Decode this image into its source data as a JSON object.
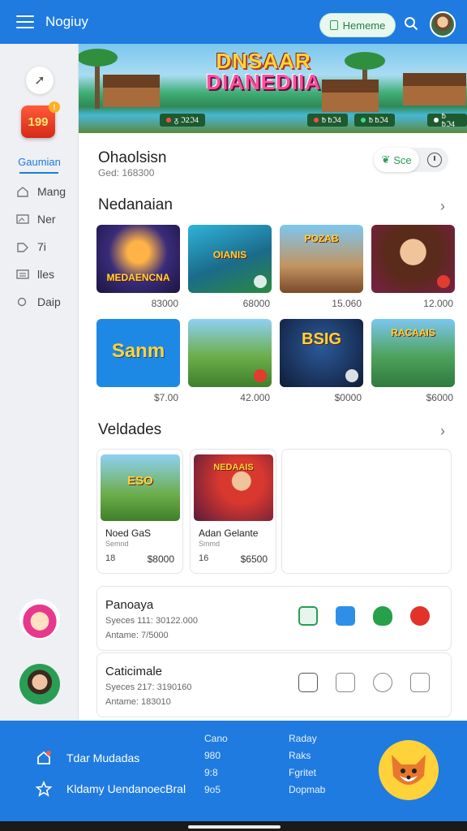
{
  "header": {
    "title": "Nogiuy",
    "home_label": "Hememe"
  },
  "banner": {
    "title_line1": "DNSAAR",
    "title_line2": "DIANEDIIA",
    "chips": [
      "ᵹ ℑ2ℑ4",
      "ƀ ƀℑ4",
      "ƀ ƀℑ4"
    ]
  },
  "sidebar": {
    "badge": "199",
    "badge_count": "!",
    "heading": "Gaumian",
    "items": [
      {
        "label": "Mang",
        "icon": "home-icon"
      },
      {
        "label": "Ner",
        "icon": "image-icon"
      },
      {
        "label": "7i",
        "icon": "tag-icon"
      },
      {
        "label": "lles",
        "icon": "list-icon"
      },
      {
        "label": "Dаip",
        "icon": "search-icon"
      }
    ]
  },
  "profile": {
    "name": "Ohaolsisn",
    "sub": "Ged: 168300",
    "see_label": "Sce"
  },
  "sections": {
    "section1": "Nedanaian",
    "section2": "Veldades"
  },
  "games": [
    {
      "label": "MEDAENCNA",
      "price": "83000"
    },
    {
      "label": "OIANIS",
      "price": "68000"
    },
    {
      "label": "POZAB",
      "price": "15.060"
    },
    {
      "label": "",
      "price": "12.000"
    },
    {
      "label": "Sanm",
      "price": "$7.00"
    },
    {
      "label": "",
      "price": "42.000"
    },
    {
      "label": "BSIG",
      "price": "$0000"
    },
    {
      "label": "RACAAIS",
      "price": "$6000"
    }
  ],
  "vel_cards": [
    {
      "thumb": "ESO",
      "title": "Noed GaS",
      "sub": "Semnd",
      "num": "18",
      "price": "$8000"
    },
    {
      "thumb": "NEDAAIS",
      "title": "Adan Gelante",
      "sub": "Smmd",
      "num": "16",
      "price": "$6500"
    }
  ],
  "info_cards": [
    {
      "title": "Panoaya",
      "sub": "Syeces 111: 30122.000",
      "amt": "Antame: 7/5000"
    },
    {
      "title": "Caticimale",
      "sub": "Syeces 217: 3190160",
      "amt": "Antame: 183010"
    }
  ],
  "footer": {
    "item1": "Tdar Mudadas",
    "item2": "Kldamy UendanoecBral",
    "col1": [
      "Cano",
      "980",
      "9:8",
      "9o5"
    ],
    "col2": [
      "Radаy",
      "Raks",
      "Fgritet",
      "Dopmab"
    ]
  }
}
